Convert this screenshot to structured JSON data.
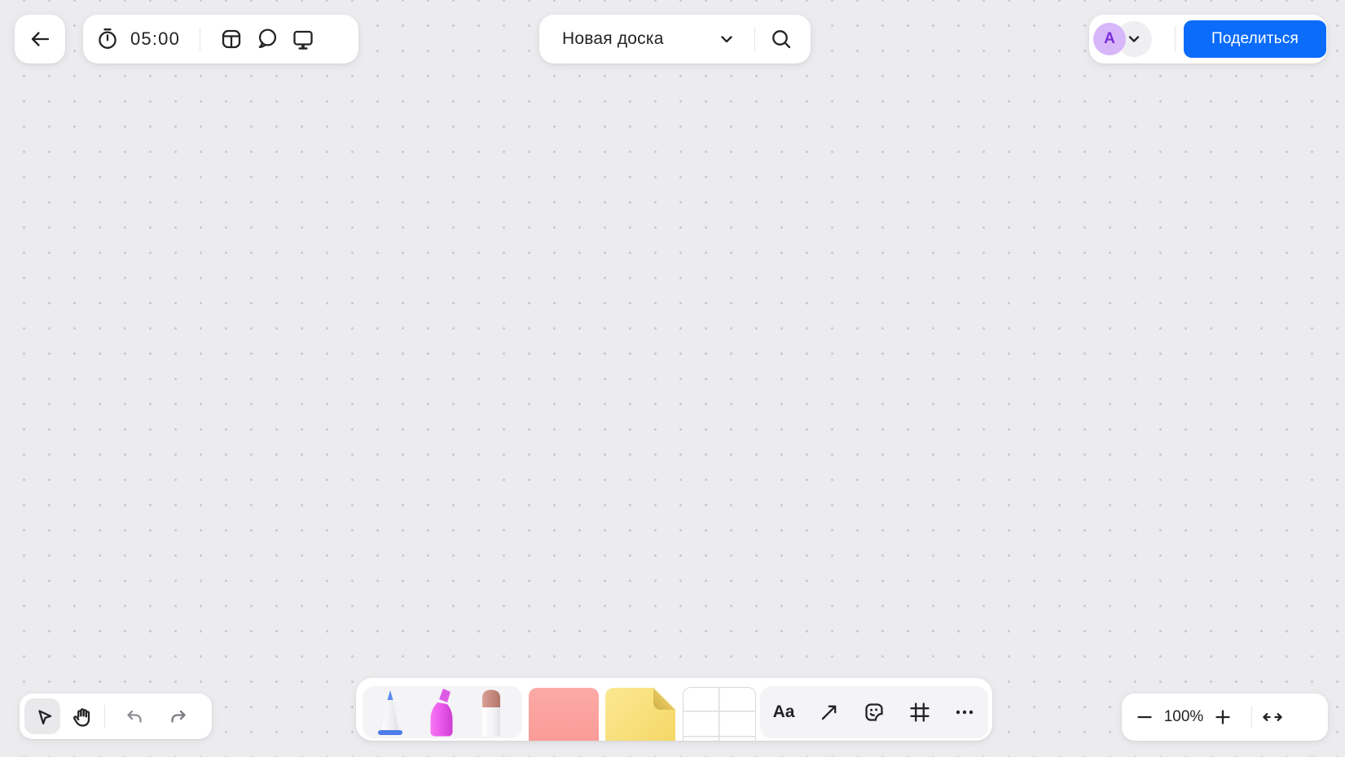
{
  "colors": {
    "bg": "#ECECEF",
    "dot": "#C9C9D1",
    "ink": "#232327",
    "blue": "#0B6CFB",
    "pink": "#FBA29F",
    "yellow": "#F8DF7B",
    "avatar-bg": "#D7B6FA",
    "avatar-text": "#7A2FD9",
    "panel": "#F4F4F6",
    "selected": "#E9E9EC"
  },
  "topbar": {
    "back": {
      "icon": "arrow-left-icon"
    },
    "timer": {
      "time": "05:00",
      "icon": "stopwatch-icon"
    },
    "actions": {
      "icons": [
        "template-icon",
        "chat-icon",
        "present-icon"
      ]
    },
    "board": {
      "title": "Новая доска",
      "dropdown_icon": "chevron-down-icon",
      "search_icon": "search-icon"
    },
    "account": {
      "avatar_letter": "A",
      "dropdown_icon": "chevron-down-icon",
      "share_label": "Поделиться"
    }
  },
  "left_toolbar": {
    "tools": [
      "select-cursor",
      "hand",
      "undo",
      "redo"
    ],
    "selected_tool": "select-cursor"
  },
  "center_toolbar": {
    "pens": [
      "marker-blue",
      "highlighter-pink",
      "eraser"
    ],
    "objects": [
      "section-pink",
      "sticky-note-yellow",
      "table"
    ],
    "text_tool_label": "Aa",
    "icons": [
      "text-tool",
      "connector-arrow-icon",
      "sticker-icon",
      "frame-icon",
      "more-icon"
    ]
  },
  "zoombar": {
    "zoom_out_icon": "minus-icon",
    "zoom_value": "100%",
    "zoom_in_icon": "plus-icon",
    "fit_icon": "arrows-horizontal-icon"
  }
}
